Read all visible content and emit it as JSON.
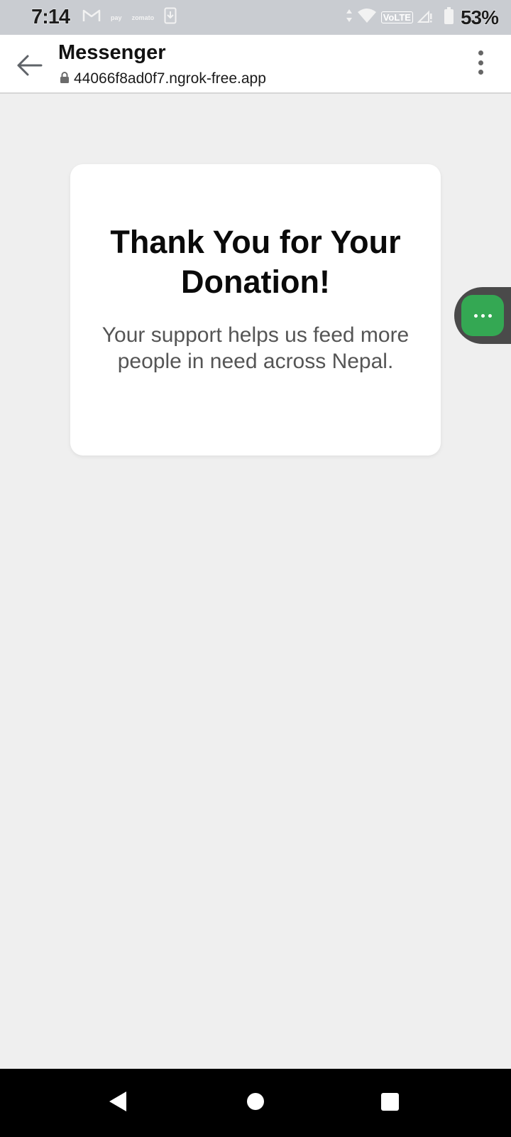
{
  "status_bar": {
    "time": "7:14",
    "left_icons": [
      "gmail-icon",
      "pay-app-icon",
      "zomato-icon",
      "download-icon"
    ],
    "pay_label": "pay",
    "zomato_label": "zomato",
    "right_icons": [
      "data-arrows-icon",
      "wifi-icon",
      "volte-icon",
      "signal-icon",
      "battery-icon"
    ],
    "volte_label": "VoLTE",
    "battery_percent": "53%"
  },
  "app_bar": {
    "title": "Messenger",
    "url": "44066f8ad0f7.ngrok-free.app"
  },
  "card": {
    "title": "Thank You for Your Donation!",
    "message": "Your support helps us feed more people in need across Nepal."
  },
  "floating_button": {
    "icon": "more-horizontal-icon",
    "color": "#34a853"
  },
  "colors": {
    "background": "#efefef",
    "card": "#ffffff",
    "accent": "#34a853",
    "status_bar": "#c9ccd1"
  }
}
